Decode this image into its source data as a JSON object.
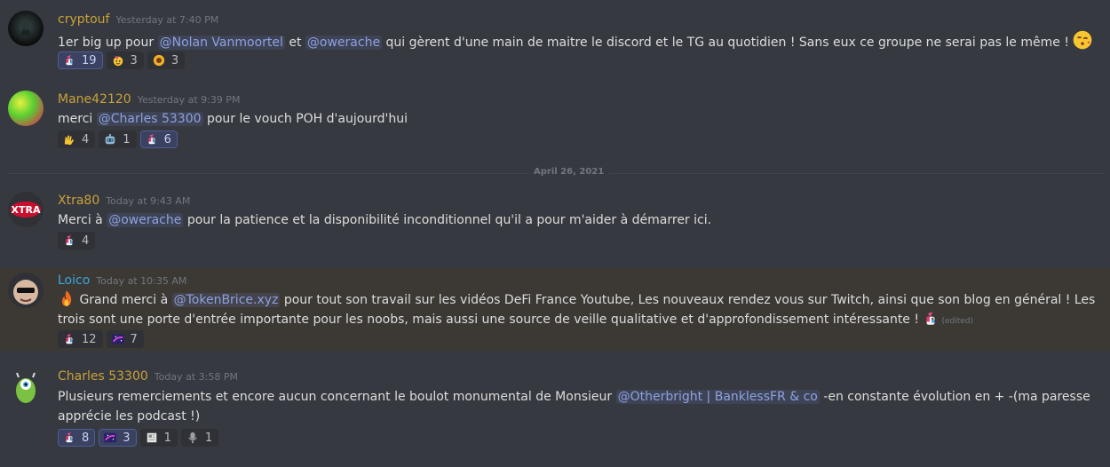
{
  "colors": {
    "background": "#36393f",
    "mention_bg": "#3d4270",
    "mention_text": "#8ea1e1",
    "highlight_row": "#3c3935"
  },
  "divider": {
    "label": "April 26, 2021"
  },
  "messages": [
    {
      "username": "cryptouf",
      "username_color": "#c9a13a",
      "timestamp": "Yesterday at 7:40 PM",
      "parts": {
        "t1": "1er big up pour ",
        "m1": "@Nolan Vanmoortel",
        "t2": " et ",
        "m2": "@owerache",
        "t3": " qui gèrent d'une main de maitre le discord et le TG au quotidien ! Sans eux ce groupe ne serai pas le même ! "
      },
      "trailing_emoji": "kissing-heart-emoji",
      "reactions": [
        {
          "icon": "unicorn-icon",
          "count": "19",
          "me": true
        },
        {
          "icon": "party-face-icon",
          "count": "3",
          "me": false
        },
        {
          "icon": "sunflower-icon",
          "count": "3",
          "me": false
        }
      ]
    },
    {
      "username": "Mane42120",
      "username_color": "#c9a13a",
      "timestamp": "Yesterday at 9:39 PM",
      "parts": {
        "t1": "merci ",
        "m1": "@Charles 53300",
        "t2": " pour le vouch POH d'aujourd'hui"
      },
      "reactions": [
        {
          "icon": "raised-hands-icon",
          "count": "4",
          "me": false
        },
        {
          "icon": "robot-icon",
          "count": "1",
          "me": false
        },
        {
          "icon": "unicorn-icon",
          "count": "6",
          "me": true
        }
      ]
    },
    {
      "username": "Xtra80",
      "username_color": "#c9a13a",
      "timestamp": "Today at 9:43 AM",
      "parts": {
        "t1": "Merci à ",
        "m1": "@owerache",
        "t2": " pour la patience et la disponibilité inconditionnel qu'il a pour m'aider à démarrer ici."
      },
      "reactions": [
        {
          "icon": "unicorn-icon",
          "count": "4",
          "me": false
        }
      ]
    },
    {
      "username": "Loico",
      "username_color": "#3ba6e0",
      "timestamp": "Today at 10:35 AM",
      "parts": {
        "t1": " Grand merci à ",
        "m1": "@TokenBrice.xyz",
        "t2": "  pour tout son travail sur les vidéos DeFi France Youtube, Les nouveaux rendez vous sur Twitch, ainsi que son blog en général ! Les trois sont une porte d'entrée importante pour les noobs, mais aussi une source de veille qualitative et d'approfondissement intéressante ! ",
        "edited": "(edited)"
      },
      "leading_emoji": "fire-emoji",
      "trailing_emoji": "unicorn-emoji",
      "reactions": [
        {
          "icon": "unicorn-icon",
          "count": "12",
          "me": false
        },
        {
          "icon": "galaxy-icon",
          "count": "7",
          "me": false
        }
      ]
    },
    {
      "username": "Charles 53300",
      "username_color": "#c9a13a",
      "timestamp": "Today at 3:58 PM",
      "parts": {
        "t1": "Plusieurs remerciements et encore aucun concernant le boulot monumental de Monsieur ",
        "m1": "@Otherbright | BanklessFR & co",
        "t2": " -en constante évolution en + -(ma paresse apprécie les podcast !)"
      },
      "reactions": [
        {
          "icon": "unicorn-icon",
          "count": "8",
          "me": true
        },
        {
          "icon": "galaxy-icon",
          "count": "3",
          "me": true
        },
        {
          "icon": "newspaper-icon",
          "count": "1",
          "me": false
        },
        {
          "icon": "microphone-icon",
          "count": "1",
          "me": false
        }
      ]
    }
  ]
}
